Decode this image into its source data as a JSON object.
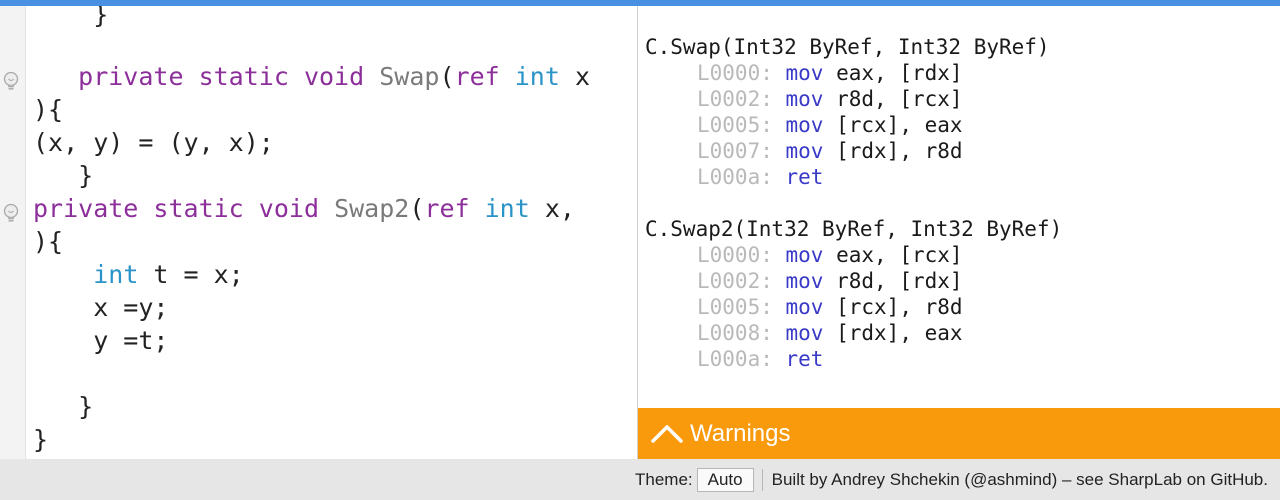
{
  "editor": {
    "lines": [
      {
        "segments": [
          {
            "t": "    }",
            "c": "plain"
          }
        ]
      },
      {
        "segments": [
          {
            "t": "   ",
            "c": "plain"
          },
          {
            "t": "private",
            "c": "kw"
          },
          {
            "t": " ",
            "c": "plain"
          },
          {
            "t": "static",
            "c": "kw"
          },
          {
            "t": " ",
            "c": "plain"
          },
          {
            "t": "void",
            "c": "kw"
          },
          {
            "t": " ",
            "c": "plain"
          },
          {
            "t": "Swap",
            "c": "fn"
          },
          {
            "t": "(",
            "c": "plain"
          },
          {
            "t": "ref",
            "c": "kw"
          },
          {
            "t": " ",
            "c": "plain"
          },
          {
            "t": "int",
            "c": "ty"
          },
          {
            "t": " x",
            "c": "plain"
          }
        ]
      },
      {
        "segments": [
          {
            "t": "){",
            "c": "plain"
          }
        ]
      },
      {
        "segments": [
          {
            "t": "(x, y) = (y, x);",
            "c": "plain"
          }
        ]
      },
      {
        "segments": [
          {
            "t": "   }",
            "c": "plain"
          }
        ]
      },
      {
        "segments": [
          {
            "t": "private",
            "c": "kw"
          },
          {
            "t": " ",
            "c": "plain"
          },
          {
            "t": "static",
            "c": "kw"
          },
          {
            "t": " ",
            "c": "plain"
          },
          {
            "t": "void",
            "c": "kw"
          },
          {
            "t": " ",
            "c": "plain"
          },
          {
            "t": "Swap2",
            "c": "fn"
          },
          {
            "t": "(",
            "c": "plain"
          },
          {
            "t": "ref",
            "c": "kw"
          },
          {
            "t": " ",
            "c": "plain"
          },
          {
            "t": "int",
            "c": "ty"
          },
          {
            "t": " x,",
            "c": "plain"
          }
        ]
      },
      {
        "segments": [
          {
            "t": "){",
            "c": "plain"
          }
        ]
      },
      {
        "segments": [
          {
            "t": "    ",
            "c": "plain"
          },
          {
            "t": "int",
            "c": "ty"
          },
          {
            "t": " t = x;",
            "c": "plain"
          }
        ]
      },
      {
        "segments": [
          {
            "t": "    x =y;",
            "c": "plain"
          }
        ]
      },
      {
        "segments": [
          {
            "t": "    y =t;",
            "c": "plain"
          }
        ]
      },
      {
        "segments": [
          {
            "t": "",
            "c": "plain"
          }
        ]
      },
      {
        "segments": [
          {
            "t": "   }",
            "c": "plain"
          }
        ]
      },
      {
        "segments": [
          {
            "t": "}",
            "c": "plain"
          }
        ]
      }
    ],
    "gutter_icons": [
      "lightbulb-icon",
      "lightbulb-icon"
    ]
  },
  "assembly": {
    "lines": [
      {
        "kind": "blank"
      },
      {
        "kind": "header",
        "text": "C.Swap(Int32 ByRef, Int32 ByRef)"
      },
      {
        "kind": "instr",
        "addr": "L0000:",
        "op": "mov",
        "args": "eax, [rdx]"
      },
      {
        "kind": "instr",
        "addr": "L0002:",
        "op": "mov",
        "args": "r8d, [rcx]"
      },
      {
        "kind": "instr",
        "addr": "L0005:",
        "op": "mov",
        "args": "[rcx], eax"
      },
      {
        "kind": "instr",
        "addr": "L0007:",
        "op": "mov",
        "args": "[rdx], r8d"
      },
      {
        "kind": "instr",
        "addr": "L000a:",
        "op": "ret",
        "args": ""
      },
      {
        "kind": "blank"
      },
      {
        "kind": "header",
        "text": "C.Swap2(Int32 ByRef, Int32 ByRef)"
      },
      {
        "kind": "instr",
        "addr": "L0000:",
        "op": "mov",
        "args": "eax, [rcx]"
      },
      {
        "kind": "instr",
        "addr": "L0002:",
        "op": "mov",
        "args": "r8d, [rdx]"
      },
      {
        "kind": "instr",
        "addr": "L0005:",
        "op": "mov",
        "args": "[rcx], r8d"
      },
      {
        "kind": "instr",
        "addr": "L0008:",
        "op": "mov",
        "args": "[rdx], eax"
      },
      {
        "kind": "instr",
        "addr": "L000a:",
        "op": "ret",
        "args": ""
      }
    ]
  },
  "warnings": {
    "label": "Warnings",
    "icon": "chevron-up-icon",
    "color": "#f99a0d"
  },
  "footer": {
    "theme_label": "Theme:",
    "theme_value": "Auto",
    "credit": "Built by Andrey Shchekin (@ashmind) – see SharpLab on GitHub."
  },
  "colors": {
    "accent": "#4a90e2",
    "keyword": "#8c2f9a",
    "type": "#2a93c8",
    "method": "#7a7a7a",
    "asm_opcode": "#3a3ac8",
    "asm_address": "#b9b9b9"
  }
}
